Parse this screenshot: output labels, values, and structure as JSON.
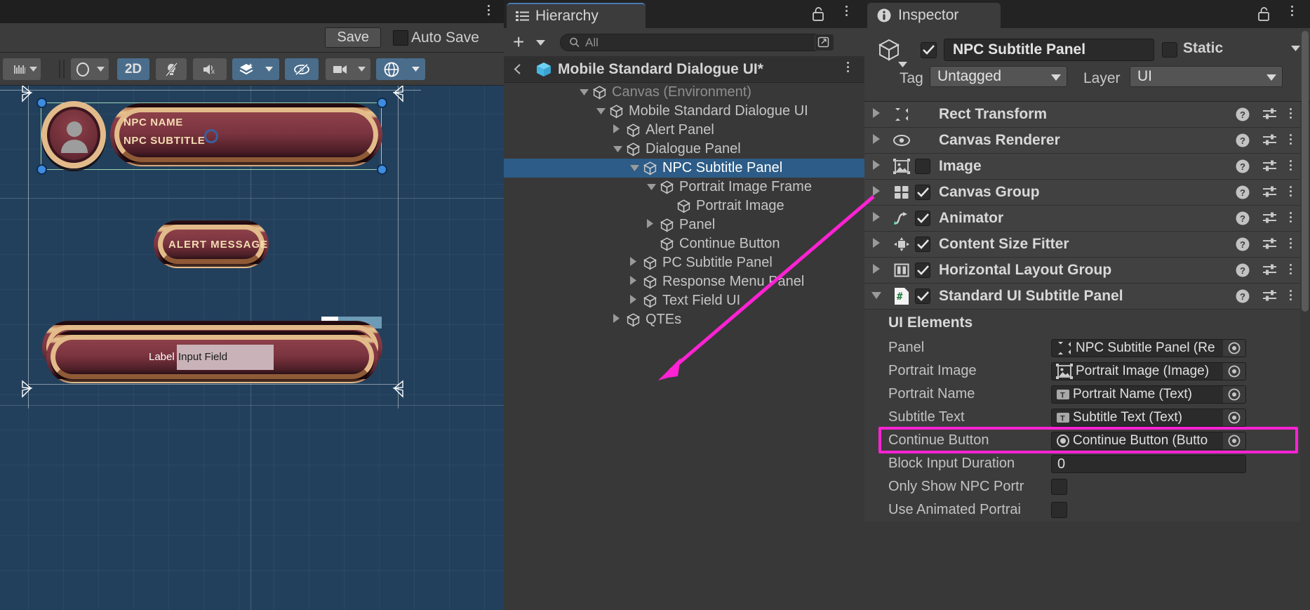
{
  "scene": {
    "tab_kebab": "more-options",
    "save_label": "Save",
    "autosave_label": "Auto Save",
    "toolbar": {
      "grid_icon": "grid-snap-icon",
      "shading_icon": "draw-mode-icon",
      "mode_2d": "2D",
      "lighting_icon": "lighting-off-icon",
      "audio_icon": "audio-off-icon",
      "fx_icon": "effects-icon",
      "hidden_icon": "hidden-objects-icon",
      "camera_icon": "scene-camera-icon",
      "gizmos_icon": "gizmos-icon"
    },
    "game_ui": {
      "npc_name": "NPC NAME",
      "npc_subtitle": "NPC SUBTITLE",
      "alert_message": "ALERT MESSAGE",
      "input_label": "Label",
      "input_value": "Input Field"
    }
  },
  "hierarchy": {
    "tab_label": "Hierarchy",
    "tab_icon": "hierarchy-icon",
    "add_label": "+",
    "search_placeholder": "All",
    "search_icon": "search-icon",
    "breadcrumb": "Mobile Standard Dialogue UI*",
    "breadcrumb_icon": "prefab-cube-icon",
    "back_icon": "chevron-left-icon",
    "items": [
      {
        "label": "Canvas (Environment)",
        "depth": 1,
        "caret": "down",
        "dim": true,
        "selected": false
      },
      {
        "label": "Mobile Standard Dialogue UI",
        "depth": 2,
        "caret": "down",
        "dim": false,
        "selected": false
      },
      {
        "label": "Alert Panel",
        "depth": 3,
        "caret": "right",
        "dim": false,
        "selected": false
      },
      {
        "label": "Dialogue Panel",
        "depth": 3,
        "caret": "down",
        "dim": false,
        "selected": false
      },
      {
        "label": "NPC Subtitle Panel",
        "depth": 4,
        "caret": "down",
        "dim": false,
        "selected": true
      },
      {
        "label": "Portrait Image Frame",
        "depth": 5,
        "caret": "down",
        "dim": false,
        "selected": false
      },
      {
        "label": "Portrait Image",
        "depth": 6,
        "caret": "none",
        "dim": false,
        "selected": false
      },
      {
        "label": "Panel",
        "depth": 5,
        "caret": "right",
        "dim": false,
        "selected": false
      },
      {
        "label": "Continue Button",
        "depth": 5,
        "caret": "none",
        "dim": false,
        "selected": false
      },
      {
        "label": "PC Subtitle Panel",
        "depth": 4,
        "caret": "right",
        "dim": false,
        "selected": false
      },
      {
        "label": "Response Menu Panel",
        "depth": 4,
        "caret": "right",
        "dim": false,
        "selected": false
      },
      {
        "label": "Text Field UI",
        "depth": 4,
        "caret": "right",
        "dim": false,
        "selected": false
      },
      {
        "label": "QTEs",
        "depth": 3,
        "caret": "right",
        "dim": false,
        "selected": false
      }
    ]
  },
  "inspector": {
    "tab_label": "Inspector",
    "tab_icon": "info-icon",
    "object_name": "NPC Subtitle Panel",
    "object_enabled": true,
    "static_label": "Static",
    "static_checked": false,
    "tag_label": "Tag",
    "tag_value": "Untagged",
    "layer_label": "Layer",
    "layer_value": "UI",
    "components": [
      {
        "name": "Rect Transform",
        "icon": "rect-transform-icon",
        "has_checkbox": false,
        "checked": false,
        "expanded": false
      },
      {
        "name": "Canvas Renderer",
        "icon": "canvas-renderer-icon",
        "has_checkbox": false,
        "checked": false,
        "expanded": false
      },
      {
        "name": "Image",
        "icon": "image-icon",
        "has_checkbox": true,
        "checked": false,
        "expanded": false
      },
      {
        "name": "Canvas Group",
        "icon": "canvas-group-icon",
        "has_checkbox": true,
        "checked": true,
        "expanded": false
      },
      {
        "name": "Animator",
        "icon": "animator-icon",
        "has_checkbox": true,
        "checked": true,
        "expanded": false
      },
      {
        "name": "Content Size Fitter",
        "icon": "content-size-fitter-icon",
        "has_checkbox": true,
        "checked": true,
        "expanded": false
      },
      {
        "name": "Horizontal Layout Group",
        "icon": "layout-group-icon",
        "has_checkbox": true,
        "checked": true,
        "expanded": false
      },
      {
        "name": "Standard UI Subtitle Panel",
        "icon": "script-icon",
        "has_checkbox": true,
        "checked": true,
        "expanded": true
      }
    ],
    "comp_help_icon": "help-icon",
    "comp_preset_icon": "preset-icon",
    "comp_menu_icon": "kebab-icon",
    "ui_elements_header": "UI Elements",
    "properties": [
      {
        "label": "Panel",
        "type": "object",
        "value": "NPC Subtitle Panel (Re",
        "icon": "rect-transform-icon",
        "highlighted": false
      },
      {
        "label": "Portrait Image",
        "type": "object",
        "value": "Portrait Image (Image)",
        "icon": "image-icon",
        "highlighted": true
      },
      {
        "label": "Portrait Name",
        "type": "object",
        "value": "Portrait Name (Text)",
        "icon": "text-icon",
        "highlighted": false
      },
      {
        "label": "Subtitle Text",
        "type": "object",
        "value": "Subtitle Text (Text)",
        "icon": "text-icon",
        "highlighted": false
      },
      {
        "label": "Continue Button",
        "type": "object",
        "value": "Continue Button (Butto",
        "icon": "button-icon",
        "highlighted": false
      },
      {
        "label": "Block Input Duration",
        "type": "number",
        "value": "0",
        "icon": "",
        "highlighted": false
      },
      {
        "label": "Only Show NPC Portr",
        "type": "bool",
        "value": "",
        "icon": "",
        "highlighted": false
      },
      {
        "label": "Use Animated Portrai",
        "type": "bool",
        "value": "",
        "icon": "",
        "highlighted": false
      }
    ]
  },
  "annotation": {
    "highlight_color": "#ff22d4",
    "arrow_name": "magenta-pointer-arrow"
  }
}
